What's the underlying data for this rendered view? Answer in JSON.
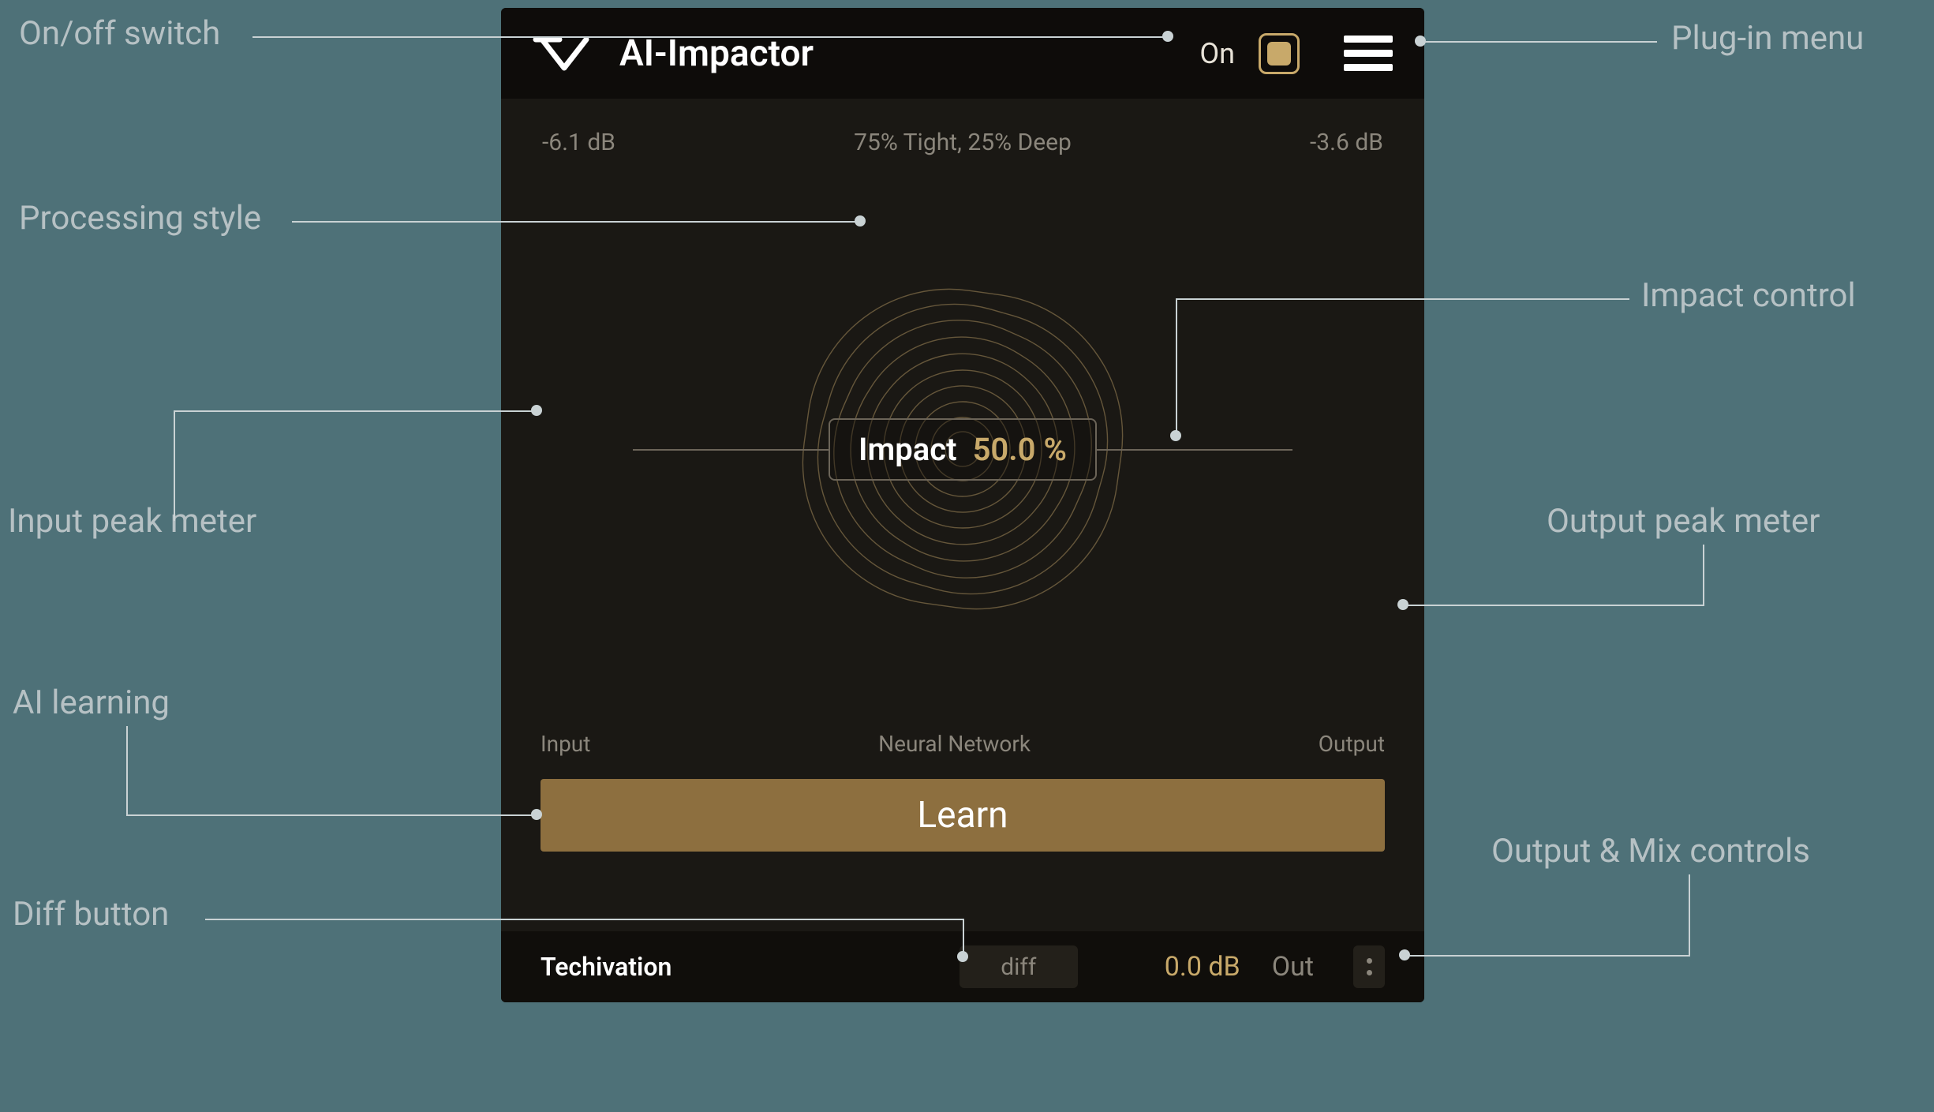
{
  "annotations": {
    "on_off": "On/off switch",
    "plugin_menu": "Plug-in menu",
    "processing_style": "Processing style",
    "impact_control": "Impact control",
    "input_meter": "Input peak meter",
    "output_meter": "Output peak meter",
    "ai_learning": "AI learning",
    "output_mix": "Output & Mix controls",
    "diff_button": "Diff button"
  },
  "plugin": {
    "title": "AI-Impactor",
    "on_label": "On",
    "on_state": true,
    "input_db": "-6.1 dB",
    "output_db": "-3.6 dB",
    "style_text": "75% Tight, 25% Deep",
    "impact_label": "Impact",
    "impact_value": "50.0 %",
    "input_label": "Input",
    "viz_label": "Neural Network",
    "output_label": "Output",
    "learn_label": "Learn",
    "brand": "Techivation",
    "diff_label": "diff",
    "out_value": "0.0 dB",
    "out_label": "Out",
    "colors": {
      "accent": "#c8a96a",
      "window_bg": "#1a1814",
      "header_bg": "#0e0c0a"
    }
  }
}
